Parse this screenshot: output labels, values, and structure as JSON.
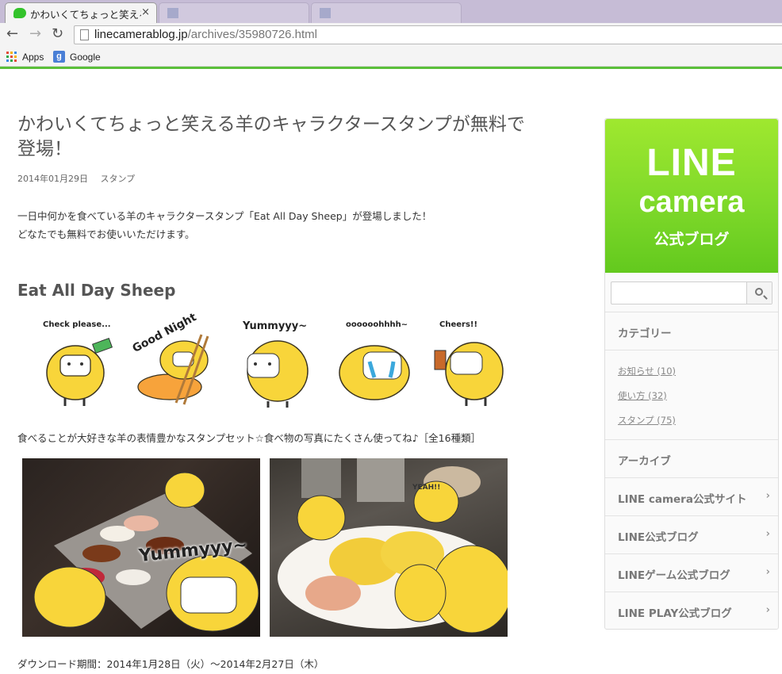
{
  "browser": {
    "active_tab_title": "かわいくてちょっと笑える",
    "tab_close": "×",
    "ghost_tab_1": "",
    "ghost_tab_2": "",
    "ghost_tab_3": "",
    "url_host": "linecamerablog.jp",
    "url_path": "/archives/35980726.html",
    "bookmarks": [
      {
        "label": "Apps",
        "icon": "apps-grid-icon"
      },
      {
        "label": "Google",
        "icon": "google-icon"
      }
    ],
    "accent_color": "#5bbf3a"
  },
  "article": {
    "title": "かわいくてちょっと笑える羊のキャラクタースタンプが無料で登場！",
    "date": "2014年01月29日",
    "category": "スタンプ",
    "intro_line1": "一日中何かを食べている羊のキャラクタースタンプ「Eat All Day Sheep」が登場しました！",
    "intro_line2": "どなたでも無料でお使いいただけます。",
    "section_heading": "Eat All Day Sheep",
    "stickers": [
      {
        "caption": "Check please..."
      },
      {
        "caption": "Good Night"
      },
      {
        "caption": "Yummyyy~"
      },
      {
        "caption": "oooooohhhh~"
      },
      {
        "caption": "Cheers!!"
      }
    ],
    "set_description": "食べることが大好きな羊の表情豊かなスタンプセット☆食べ物の写真にたくさん使ってね♪［全16種類］",
    "photo1_labels": [
      "Yummyyy~"
    ],
    "photo2_labels": [
      "YEAH!!"
    ],
    "download_period": "ダウンロード期間：2014年1月28日（火）〜2014年2月27日（木）"
  },
  "sidebar": {
    "logo_line1": "LINE",
    "logo_line2": "camera",
    "logo_line3": "公式ブログ",
    "search_placeholder": "",
    "categories_heading": "カテゴリー",
    "categories": [
      {
        "label": "お知らせ (10)"
      },
      {
        "label": "使い方 (32)"
      },
      {
        "label": "スタンプ (75)"
      }
    ],
    "archive_heading": "アーカイブ",
    "links": [
      {
        "label": "LINE camera公式サイト"
      },
      {
        "label": "LINE公式ブログ"
      },
      {
        "label": "LINEゲーム公式ブログ"
      },
      {
        "label": "LINE PLAY公式ブログ"
      }
    ],
    "chevron": "›"
  }
}
